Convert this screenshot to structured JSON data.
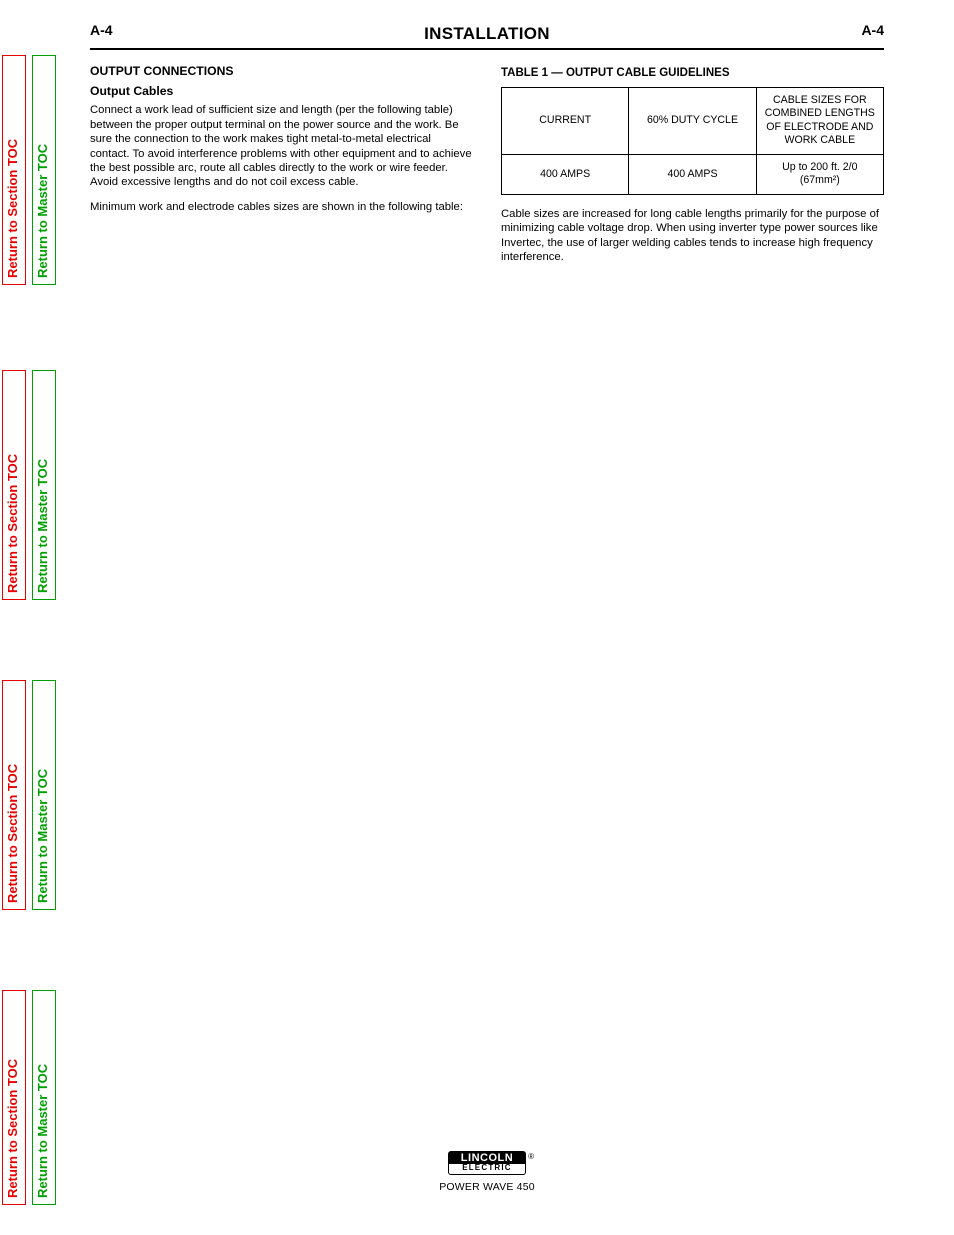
{
  "toc": {
    "section_label": "Return to Section TOC",
    "master_label": "Return to Master TOC"
  },
  "header": {
    "page_code": "A-4",
    "title": "INSTALLATION"
  },
  "left_col": {
    "h1": "OUTPUT CONNECTIONS",
    "h2": "Output Cables",
    "p1": "Connect a work lead of sufficient size and length (per the following table) between the proper output terminal on the power source and the work. Be sure the connection to the work makes tight metal-to-metal electrical contact. To avoid interference problems with other equipment and to achieve the best possible arc, route all cables directly to the work or wire feeder. Avoid excessive lengths and do not coil excess cable.",
    "p2": "Minimum work and electrode cables sizes are shown in the following table:"
  },
  "right_col": {
    "table_title": "TABLE 1 — OUTPUT CABLE GUIDELINES",
    "table": {
      "header": [
        "CURRENT",
        "60% DUTY CYCLE",
        "CABLE SIZES FOR COMBINED LENGTHS OF ELECTRODE AND WORK CABLE"
      ],
      "row": [
        "400 AMPS",
        "400 AMPS",
        "Up to 200 ft. 2/0 (67mm²)"
      ]
    },
    "p_after": "Cable sizes are increased for long cable lengths primarily for the purpose of minimizing cable voltage drop. When using inverter type power sources like Invertec, the use of larger welding cables tends to increase high frequency interference."
  },
  "footer": {
    "logo_top": "LINCOLN",
    "logo_bottom": "ELECTRIC",
    "logo_reg": "®",
    "model": "POWER WAVE 450"
  }
}
